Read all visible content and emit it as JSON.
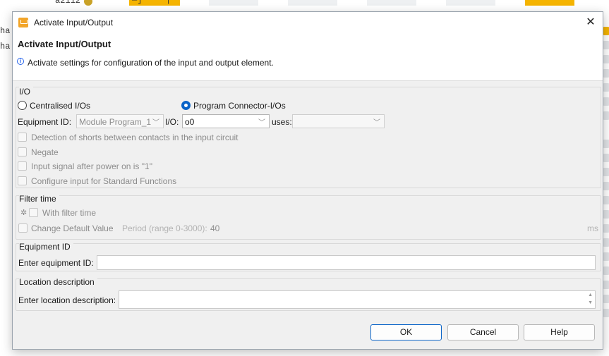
{
  "background": {
    "code_line": "a2112",
    "code_bracket": "—]",
    "code_marker": "|",
    "side_text_1": "ha",
    "side_text_2": "ha",
    "accent_color": "#f5b400"
  },
  "dialog": {
    "window_title": "Activate Input/Output",
    "header_title": "Activate Input/Output",
    "header_description": "Activate settings for configuration of the input and output element.",
    "io_group": {
      "label": "I/O",
      "radio_centralised": "Centralised I/Os",
      "radio_program_connector": "Program Connector-I/Os",
      "selected_radio": "Program Connector-I/Os",
      "equipment_id_label": "Equipment ID:",
      "equipment_id_value": "Module Program_1",
      "io_label": "I/O:",
      "io_value": "o0",
      "uses_label": "uses:",
      "uses_value": "",
      "cb_detection_shorts": "Detection of shorts between contacts in the input circuit",
      "cb_negate": "Negate",
      "cb_input_signal": "Input signal after power on is \"1\"",
      "cb_configure_input": "Configure input for Standard Functions"
    },
    "filter_group": {
      "label": "Filter time",
      "cb_with_filter_time": "With filter time",
      "cb_change_default": "Change Default Value",
      "period_label": "Period (range 0-3000):",
      "period_value": "40",
      "unit": "ms"
    },
    "equipment_group": {
      "label": "Equipment ID",
      "field_label": "Enter equipment ID:",
      "field_value": ""
    },
    "location_group": {
      "label": "Location description",
      "field_label": "Enter location description:",
      "field_value": ""
    },
    "buttons": {
      "ok": "OK",
      "cancel": "Cancel",
      "help": "Help"
    }
  }
}
